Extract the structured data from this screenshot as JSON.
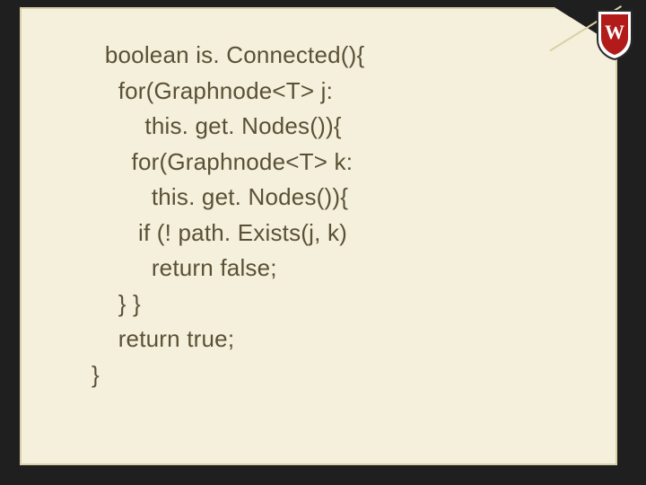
{
  "code": {
    "lines": [
      "  boolean is. Connected(){",
      "    for(Graphnode<T> j:",
      "        this. get. Nodes()){",
      "      for(Graphnode<T> k:",
      "         this. get. Nodes()){",
      "       if (! path. Exists(j, k)",
      "         return false;",
      "    } }",
      "    return true;",
      "}"
    ]
  },
  "logo": {
    "name": "wisconsin-crest",
    "letter": "W"
  }
}
